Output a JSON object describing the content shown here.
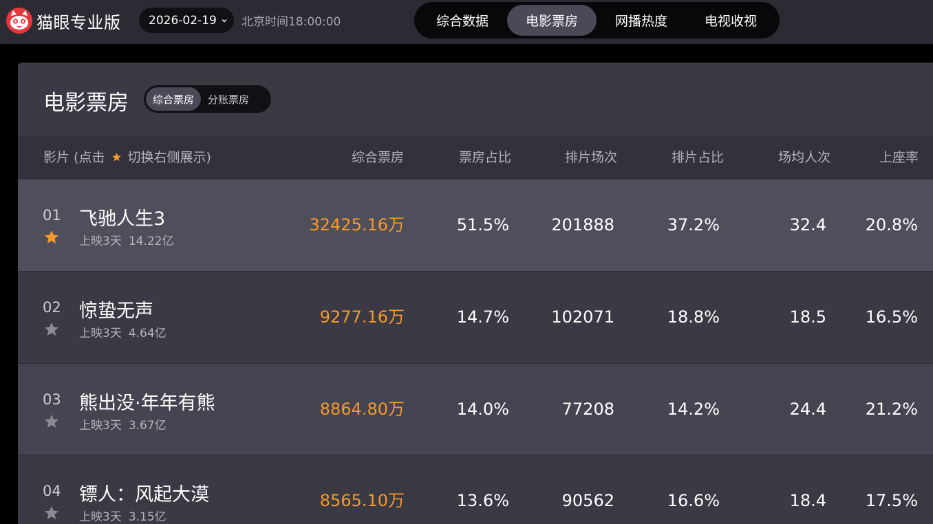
{
  "header": {
    "brand": "猫眼专业版",
    "brand_icon": "cat-logo-icon",
    "date": "2026-02-19",
    "beijing_time": "北京时间18:00:00",
    "nav": [
      {
        "label": "综合数据",
        "active": false
      },
      {
        "label": "电影票房",
        "active": true
      },
      {
        "label": "网播热度",
        "active": false
      },
      {
        "label": "电视收视",
        "active": false
      }
    ]
  },
  "panel": {
    "title": "电影票房",
    "segments": [
      {
        "label": "综合票房",
        "active": true
      },
      {
        "label": "分账票房",
        "active": false
      }
    ],
    "columns": {
      "film_prefix": "影片 (点击",
      "film_suffix": "切换右侧展示)",
      "box": "综合票房",
      "box_ratio": "票房占比",
      "shows": "排片场次",
      "show_ratio": "排片占比",
      "avg_people": "场均人次",
      "occupancy": "上座率"
    },
    "rows": [
      {
        "rank": "01",
        "name": "飞驰人生3",
        "days": "上映3天",
        "total": "14.22亿",
        "box": "32425.16万",
        "box_ratio": "51.5%",
        "shows": "201888",
        "show_ratio": "37.2%",
        "avg_people": "32.4",
        "occupancy": "20.8%",
        "starred": true
      },
      {
        "rank": "02",
        "name": "惊蛰无声",
        "days": "上映3天",
        "total": "4.64亿",
        "box": "9277.16万",
        "box_ratio": "14.7%",
        "shows": "102071",
        "show_ratio": "18.8%",
        "avg_people": "18.5",
        "occupancy": "16.5%",
        "starred": false
      },
      {
        "rank": "03",
        "name": "熊出没·年年有熊",
        "days": "上映3天",
        "total": "3.67亿",
        "box": "8864.80万",
        "box_ratio": "14.0%",
        "shows": "77208",
        "show_ratio": "14.2%",
        "avg_people": "24.4",
        "occupancy": "21.2%",
        "starred": false
      },
      {
        "rank": "04",
        "name": "镖人：风起大漠",
        "days": "上映3天",
        "total": "3.15亿",
        "box": "8565.10万",
        "box_ratio": "13.6%",
        "shows": "90562",
        "show_ratio": "16.6%",
        "avg_people": "18.4",
        "occupancy": "17.5%",
        "starred": false
      }
    ]
  },
  "colors": {
    "accent_orange": "#f39a2c",
    "star_inactive": "#8c8b93",
    "brand_red": "#e8383d"
  }
}
